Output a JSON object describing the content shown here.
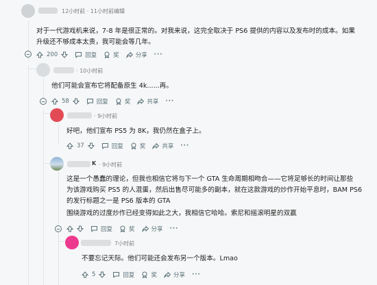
{
  "c1": {
    "time": "12小时前 · 11小时前编辑",
    "lines": [
      "对于一代游戏机来说，7-8 年是很正常的。对我来说，这完全取决于 PS6 提供的内容以及发布时的成本。如果",
      "升级还不够成本太贵，我可能会等几年。"
    ],
    "votes": "200",
    "reply": "回复",
    "award": "奖",
    "share": "分享"
  },
  "c2": {
    "time": "· 10小时前",
    "text": "他们可能会宣布它将配备原生 4k......再。",
    "votes": "58",
    "reply": "回复",
    "award": "奖",
    "share": "共享"
  },
  "c3": {
    "time": "· 9小时前",
    "text": "好吧，他们宣布 PS5 为 8K，我仍然在盒子上。",
    "votes": "37",
    "reply": "回复",
    "award": "奖",
    "share": "共享"
  },
  "c4": {
    "username": "K",
    "time": "· 9小时前",
    "lines": [
      "这是一个愚蠢的理论，但我也相信它将与下一个 GTA 生命周期相吻合——它将足够长的时间让那些",
      "为该游戏购买 PS5 的人混蛋，然后出售尽可能多的副本，就在这款游戏的炒作开始平息时，BAM PS6",
      "的发行标题之一是 PS6 版本的 GTA"
    ],
    "line2": "围绕游戏的过度炒作已经变得如此之大，我相信它哈哈。索尼和摇滚明星的双赢",
    "reply": "回复",
    "award": "奖",
    "share": "分享"
  },
  "c5": {
    "time": "7小时前",
    "text": "不要忘记天际。他们可能还会发布另一个版本。Lmao",
    "votes": "5",
    "reply": "回复",
    "award": "奖",
    "share": "分享"
  },
  "more_label": "···"
}
